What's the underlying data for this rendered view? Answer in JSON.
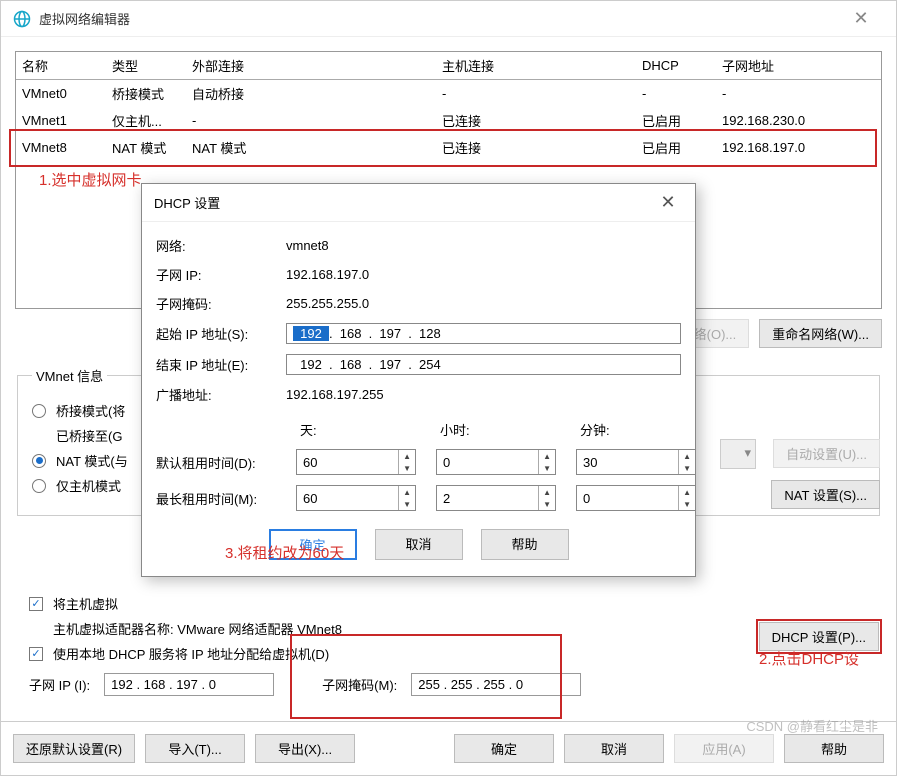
{
  "window": {
    "title": "虚拟网络编辑器"
  },
  "table": {
    "headers": {
      "name": "名称",
      "type": "类型",
      "ext": "外部连接",
      "host": "主机连接",
      "dhcp": "DHCP",
      "subnet": "子网地址"
    },
    "rows": [
      {
        "name": "VMnet0",
        "type": "桥接模式",
        "ext": "自动桥接",
        "host": "-",
        "dhcp": "-",
        "subnet": "-"
      },
      {
        "name": "VMnet1",
        "type": "仅主机...",
        "ext": "-",
        "host": "已连接",
        "dhcp": "已启用",
        "subnet": "192.168.230.0"
      },
      {
        "name": "VMnet8",
        "type": "NAT 模式",
        "ext": "NAT 模式",
        "host": "已连接",
        "dhcp": "已启用",
        "subnet": "192.168.197.0"
      }
    ]
  },
  "netButtons": {
    "add": "添加网络(O)...",
    "rename": "重命名网络(W)..."
  },
  "vmnetInfo": {
    "legend": "VMnet 信息",
    "bridgeRadio": "桥接模式(将",
    "bridgedTo": "已桥接至(G",
    "natRadio": "NAT 模式(与",
    "hostOnlyRadio": "仅主机模式",
    "connectHost": "将主机虚拟",
    "adapterName": "主机虚拟适配器名称: VMware 网络适配器 VMnet8",
    "useDhcp": "使用本地 DHCP 服务将 IP 地址分配给虚拟机(D)",
    "subnetIpLabel": "子网 IP (I):",
    "subnetIp": "192 . 168 . 197 .   0",
    "subnetMaskLabel": "子网掩码(M):",
    "subnetMask": "255 . 255 . 255 .   0"
  },
  "sideButtons": {
    "auto": "自动设置(U)...",
    "nat": "NAT 设置(S)...",
    "dhcp": "DHCP 设置(P)..."
  },
  "bottom": {
    "restore": "还原默认设置(R)",
    "import": "导入(T)...",
    "export": "导出(X)...",
    "ok": "确定",
    "cancel": "取消",
    "apply": "应用(A)",
    "help": "帮助"
  },
  "watermark": "CSDN @静看红尘是非",
  "annotations": {
    "a1": "1.选中虚拟网卡",
    "a2": "2.点击DHCP设",
    "a3": "3.将租约改为60天"
  },
  "dhcp": {
    "title": "DHCP 设置",
    "netLabel": "网络:",
    "net": "vmnet8",
    "subnetIpLabel": "子网 IP:",
    "subnetIp": "192.168.197.0",
    "maskLabel": "子网掩码:",
    "mask": "255.255.255.0",
    "startLabel": "起始 IP 地址(S):",
    "start": {
      "a": "192",
      "b": "168",
      "c": "197",
      "d": "128"
    },
    "endLabel": "结束 IP 地址(E):",
    "end": {
      "a": "192",
      "b": "168",
      "c": "197",
      "d": "254"
    },
    "bcastLabel": "广播地址:",
    "bcast": "192.168.197.255",
    "dayHdr": "天:",
    "hourHdr": "小时:",
    "minHdr": "分钟:",
    "defLeaseLabel": "默认租用时间(D):",
    "defLease": {
      "d": "60",
      "h": "0",
      "m": "30"
    },
    "maxLeaseLabel": "最长租用时间(M):",
    "maxLease": {
      "d": "60",
      "h": "2",
      "m": "0"
    },
    "ok": "确定",
    "cancel": "取消",
    "help": "帮助"
  }
}
